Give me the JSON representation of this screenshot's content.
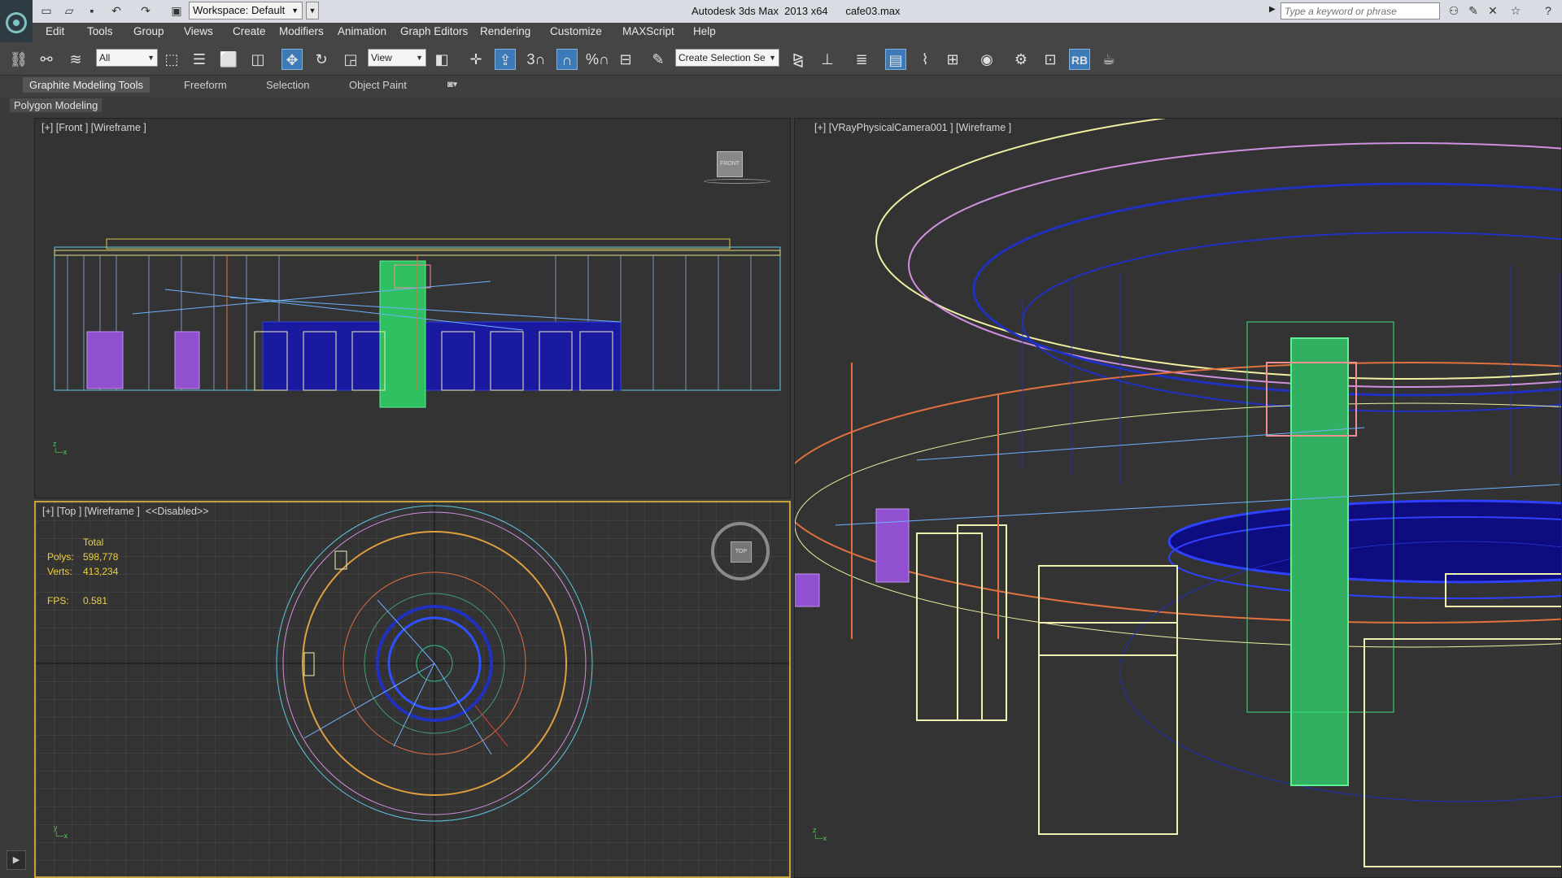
{
  "titlebar": {
    "workspace": "Workspace: Default",
    "title": "Autodesk 3ds Max  2013 x64      cafe03.max",
    "search_placeholder": "Type a keyword or phrase"
  },
  "menu": [
    "Edit",
    "Tools",
    "Group",
    "Views",
    "Create",
    "Modifiers",
    "Animation",
    "Graph Editors",
    "Rendering",
    "Customize",
    "MAXScript",
    "Help"
  ],
  "toolbar": {
    "filter_value": "All",
    "refcoord_value": "View",
    "selection_set_placeholder": "Create Selection Se",
    "snap_label": "3",
    "angle_label": "%",
    "rb_label": "RB"
  },
  "ribbon": {
    "tabs": [
      "Graphite Modeling Tools",
      "Freeform",
      "Selection",
      "Object Paint"
    ],
    "panel": "Polygon Modeling"
  },
  "viewports": {
    "front": {
      "label": "[+] [Front ] [Wireframe ]",
      "cube": "FRONT"
    },
    "top": {
      "label": "[+] [Top ] [Wireframe ]  <<Disabled>>",
      "cube": "TOP"
    },
    "camera": {
      "label": "[+] [VRayPhysicalCamera001 ] [Wireframe ]"
    }
  },
  "stats": {
    "header": "Total",
    "polys_label": "Polys:",
    "polys_value": "598,778",
    "verts_label": "Verts:",
    "verts_value": "413,234",
    "fps_label": "FPS:",
    "fps_value": "0.581"
  },
  "colors": {
    "accent": "#3d7ab8",
    "viewport_active_border": "#c7a13a",
    "stats_text": "#f0d040"
  }
}
